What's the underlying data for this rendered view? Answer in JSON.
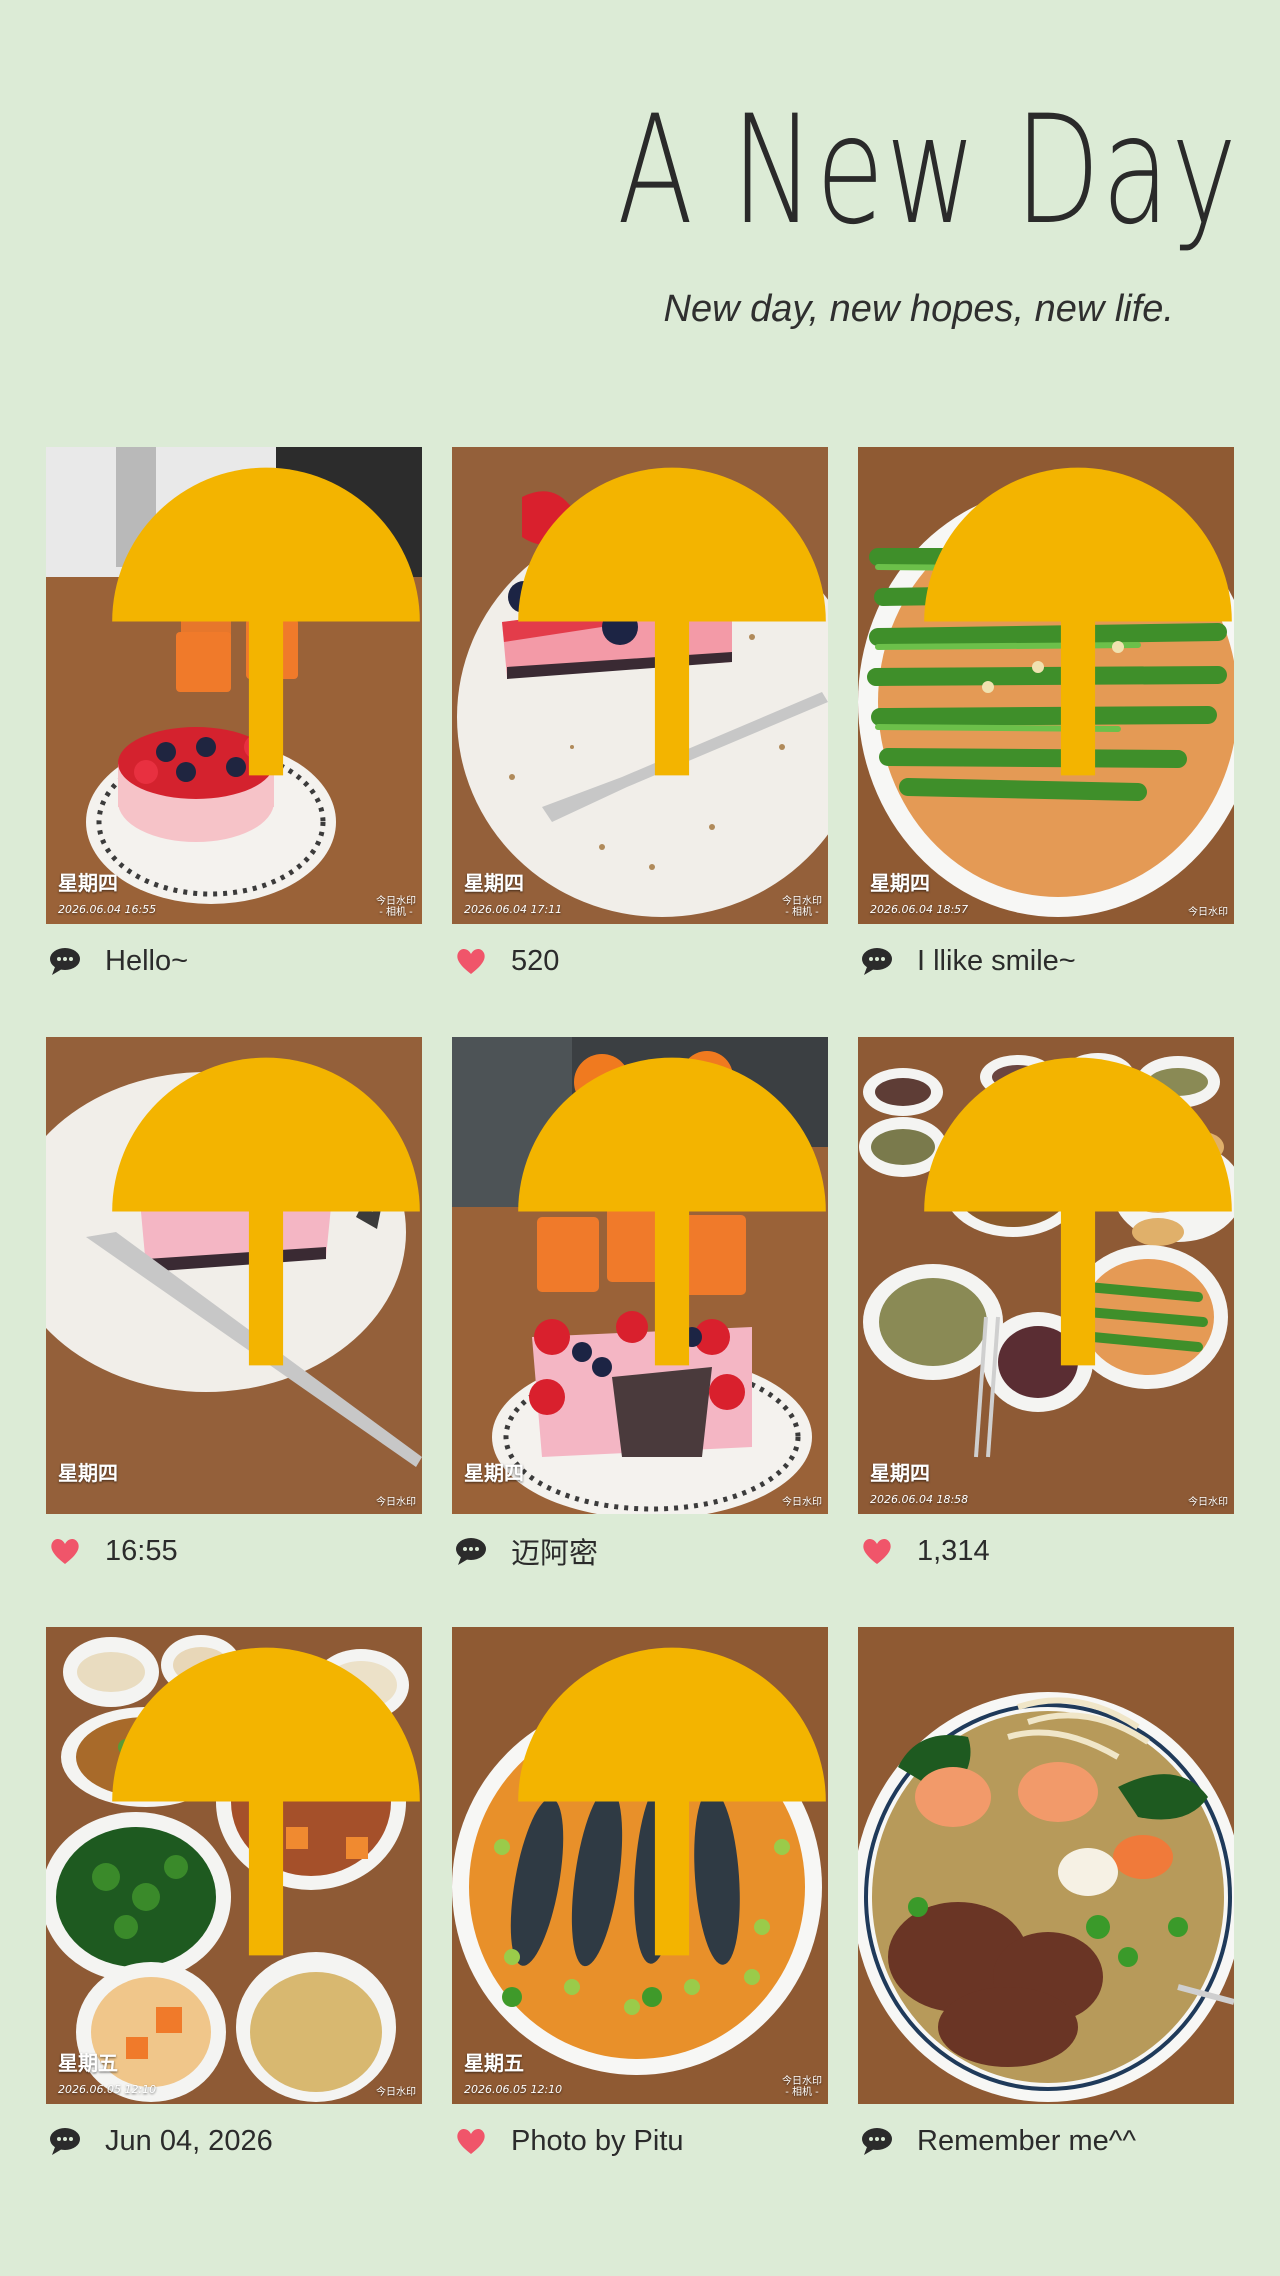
{
  "header": {
    "title": "A New Day",
    "subtitle": "New day, new hopes, new life."
  },
  "cards": [
    {
      "icon": "comment-icon",
      "caption": "Hello~",
      "stamp_day": "星期四",
      "stamp_date": "2026.06.04 16:55",
      "watermark": "今日水印\n- 相机 -"
    },
    {
      "icon": "heart-icon",
      "caption": "520",
      "stamp_day": "星期四",
      "stamp_date": "2026.06.04 17:11",
      "watermark": "今日水印\n- 相机 -"
    },
    {
      "icon": "comment-icon",
      "caption": "I llike smile~",
      "stamp_day": "星期四",
      "stamp_date": "2026.06.04 18:57",
      "watermark": "今日水印"
    },
    {
      "icon": "heart-icon",
      "caption": "16:55",
      "stamp_day": "星期四",
      "stamp_date": "",
      "watermark": "今日水印"
    },
    {
      "icon": "comment-icon",
      "caption": "迈阿密",
      "stamp_day": "星期四",
      "stamp_date": "",
      "watermark": "今日水印"
    },
    {
      "icon": "heart-icon",
      "caption": "1,314",
      "stamp_day": "星期四",
      "stamp_date": "2026.06.04 18:58",
      "watermark": "今日水印"
    },
    {
      "icon": "comment-icon",
      "caption": "Jun 04, 2026",
      "stamp_day": "星期五",
      "stamp_date": "2026.06.05 12:10",
      "watermark": "今日水印"
    },
    {
      "icon": "heart-icon",
      "caption": "Photo by Pitu",
      "stamp_day": "星期五",
      "stamp_date": "2026.06.05 12:10",
      "watermark": "今日水印\n- 相机 -"
    },
    {
      "icon": "comment-icon",
      "caption": "Remember me^^",
      "stamp_day": "",
      "stamp_date": "",
      "watermark": ""
    }
  ],
  "colors": {
    "background": "#dcebd6",
    "heart": "#f0556a",
    "comment": "#2b2b2b",
    "table_wood": "#8b5a35"
  }
}
